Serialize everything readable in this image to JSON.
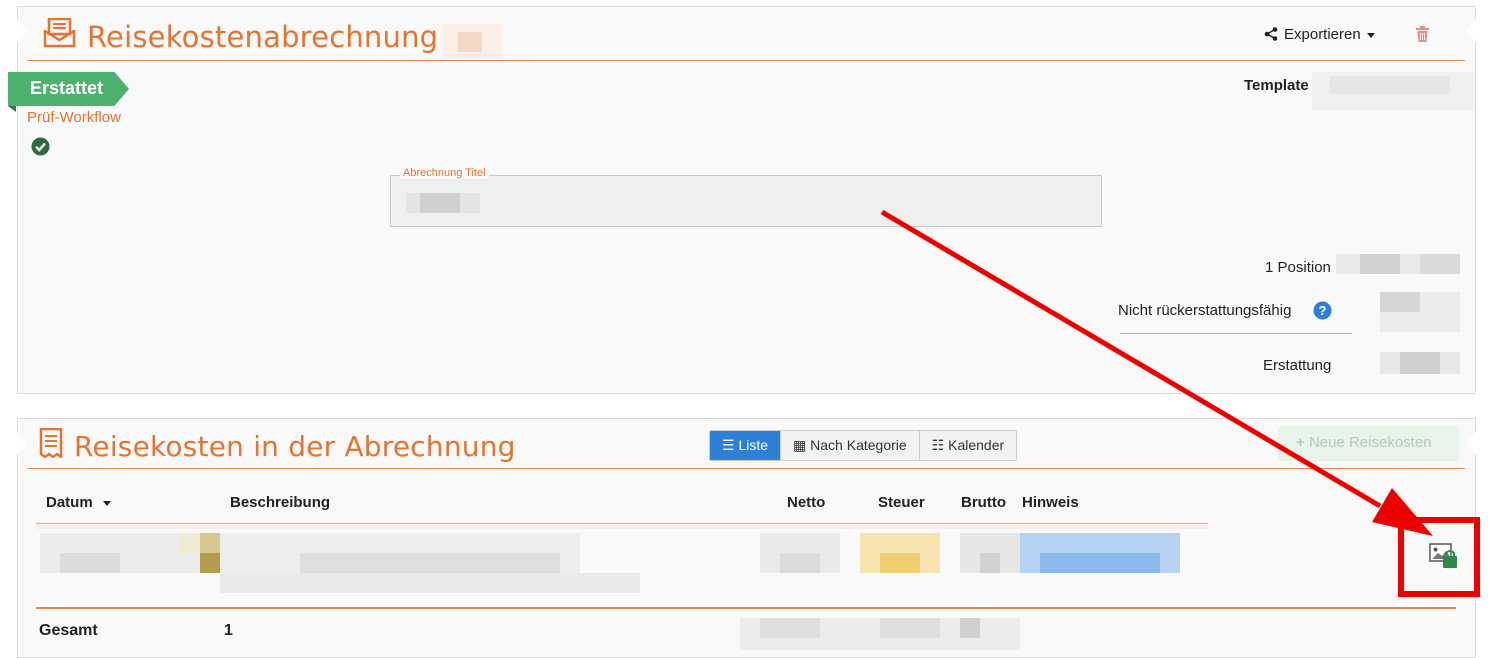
{
  "report": {
    "title": "Reisekostenabrechnung Nr.",
    "export_label": "Exportieren",
    "status_badge": "Erstattet",
    "workflow_label": "Prüf-Workflow",
    "template_label": "Template",
    "title_field_label": "Abrechnung Titel",
    "summary": {
      "positions_label": "1 Position",
      "non_refundable_label": "Nicht rückerstattungsfähig",
      "refund_label": "Erstattung"
    }
  },
  "expenses": {
    "title": "Reisekosten in der Abrechnung",
    "view_tabs": [
      {
        "label": "Liste",
        "icon": "list-icon",
        "active": true
      },
      {
        "label": "Nach Kategorie",
        "icon": "grid-icon",
        "active": false
      },
      {
        "label": "Kalender",
        "icon": "calendar-icon",
        "active": false
      }
    ],
    "new_button": "Neue Reisekosten",
    "columns": {
      "date": "Datum",
      "description": "Beschreibung",
      "net": "Netto",
      "tax": "Steuer",
      "gross": "Brutto",
      "note": "Hinweis"
    },
    "total_label": "Gesamt",
    "total_count": "1"
  },
  "colors": {
    "accent": "#e67330",
    "status_green": "#4cb26d",
    "primary_blue": "#2e7fd8",
    "highlight_red": "#ee0000"
  }
}
